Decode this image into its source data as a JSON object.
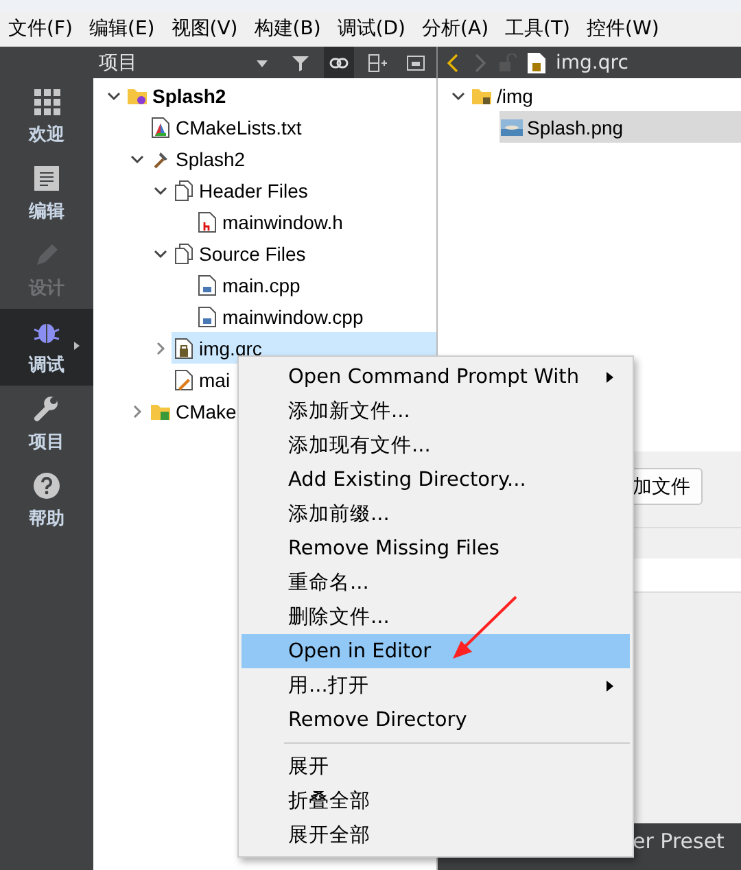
{
  "menu_bar": [
    "文件(F)",
    "编辑(E)",
    "视图(V)",
    "构建(B)",
    "调试(D)",
    "分析(A)",
    "工具(T)",
    "控件(W)"
  ],
  "mode_bar": [
    {
      "label": "欢迎",
      "kind": "welcome",
      "selected": false,
      "disabled": false
    },
    {
      "label": "编辑",
      "kind": "edit",
      "selected": false,
      "disabled": false
    },
    {
      "label": "设计",
      "kind": "design",
      "selected": false,
      "disabled": true
    },
    {
      "label": "调试",
      "kind": "debug",
      "selected": true,
      "disabled": false
    },
    {
      "label": "项目",
      "kind": "projects",
      "selected": false,
      "disabled": false
    },
    {
      "label": "帮助",
      "kind": "help",
      "selected": false,
      "disabled": false
    }
  ],
  "project_pane": {
    "title": "项目",
    "tree": [
      {
        "label": "Splash2",
        "kind": "project",
        "expanded": true,
        "selected": false,
        "children": [
          {
            "label": "CMakeLists.txt",
            "kind": "cmake",
            "selected": false
          },
          {
            "label": "Splash2",
            "kind": "target",
            "expanded": true,
            "selected": false,
            "children": [
              {
                "label": "Header Files",
                "kind": "group",
                "expanded": true,
                "selected": false,
                "children": [
                  {
                    "label": "mainwindow.h",
                    "kind": "header",
                    "selected": false
                  }
                ]
              },
              {
                "label": "Source Files",
                "kind": "group",
                "expanded": true,
                "selected": false,
                "children": [
                  {
                    "label": "main.cpp",
                    "kind": "source",
                    "selected": false
                  },
                  {
                    "label": "mainwindow.cpp",
                    "kind": "source",
                    "selected": false
                  }
                ]
              },
              {
                "label": "img.qrc",
                "kind": "qrc",
                "expanded": false,
                "selected": true
              },
              {
                "label": "mai",
                "kind": "form",
                "selected": false
              }
            ]
          },
          {
            "label": "CMake",
            "kind": "cmake-folder",
            "expanded": false,
            "selected": false
          }
        ]
      }
    ]
  },
  "editor": {
    "file_name": "img.qrc",
    "tree": [
      {
        "label": "/img",
        "kind": "prefix",
        "expanded": true,
        "selected": false,
        "children": [
          {
            "label": "Splash.png",
            "kind": "image",
            "selected": true
          }
        ]
      }
    ],
    "button": "加文件",
    "bottom_bar": "er Preset"
  },
  "context_menu": [
    {
      "kind": "item",
      "label": "Open Command Prompt With",
      "submenu": true,
      "selected": false
    },
    {
      "kind": "item",
      "label": "添加新文件...",
      "submenu": false,
      "selected": false
    },
    {
      "kind": "item",
      "label": "添加现有文件...",
      "submenu": false,
      "selected": false
    },
    {
      "kind": "item",
      "label": "Add Existing Directory...",
      "submenu": false,
      "selected": false
    },
    {
      "kind": "item",
      "label": "添加前缀...",
      "submenu": false,
      "selected": false
    },
    {
      "kind": "item",
      "label": "Remove Missing Files",
      "submenu": false,
      "selected": false
    },
    {
      "kind": "item",
      "label": "重命名...",
      "submenu": false,
      "selected": false
    },
    {
      "kind": "item",
      "label": "删除文件...",
      "submenu": false,
      "selected": false
    },
    {
      "kind": "item",
      "label": "Open in Editor",
      "submenu": false,
      "selected": true
    },
    {
      "kind": "item",
      "label": "用...打开",
      "submenu": true,
      "selected": false
    },
    {
      "kind": "item",
      "label": "Remove Directory",
      "submenu": false,
      "selected": false
    },
    {
      "kind": "separator"
    },
    {
      "kind": "item",
      "label": "展开",
      "submenu": false,
      "selected": false
    },
    {
      "kind": "item",
      "label": "折叠全部",
      "submenu": false,
      "selected": false
    },
    {
      "kind": "item",
      "label": "展开全部",
      "submenu": false,
      "selected": false
    }
  ]
}
